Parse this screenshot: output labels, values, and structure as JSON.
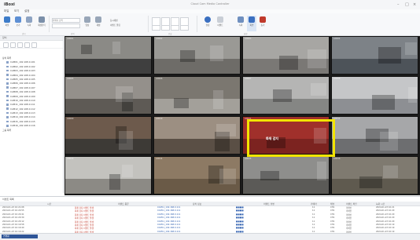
{
  "app": {
    "name": "iBoxi",
    "window_title": "Cloud Cam Media Controller"
  },
  "menubar": [
    "파일",
    "보기",
    "설정"
  ],
  "ribbon": {
    "buttons": [
      {
        "label": "파일",
        "icon": "home-icon"
      },
      {
        "label": "보기",
        "icon": "view-icon"
      },
      {
        "label": "녹화",
        "icon": "record-icon"
      },
      {
        "label": "재생관리",
        "icon": "playback-icon"
      },
      {
        "label": "영상",
        "icon": "camera-icon"
      },
      {
        "label": "재생",
        "icon": "play-icon"
      }
    ],
    "search_placeholder": "카메라 검색",
    "options": [
      "동시재생",
      "이벤트 알림"
    ],
    "group_labels": [
      "관리",
      "검색",
      "분할",
      "설정"
    ],
    "right_buttons": [
      {
        "label": "설정",
        "icon": "gear-icon"
      },
      {
        "label": "이벤트",
        "icon": "alert-icon"
      },
      {
        "label": "녹화",
        "icon": "record-icon"
      },
      {
        "label": "화면",
        "icon": "screen-icon"
      },
      {
        "label": "동기",
        "icon": "sync-icon"
      }
    ]
  },
  "sidebar": {
    "title": "장치",
    "tree": [
      "장치 목록",
      "CAM01_192.168.0.101",
      "CAM02_192.168.0.102",
      "CAM03_192.168.0.103",
      "CAM04_192.168.0.104",
      "CAM05_192.168.0.105",
      "CAM06_192.168.0.106",
      "CAM07_192.168.0.107",
      "CAM08_192.168.0.108",
      "CAM09_192.168.0.109",
      "CAM10_192.168.0.110",
      "CAM11_192.168.0.111",
      "CAM12_192.168.0.112",
      "CAM13_192.168.0.113",
      "CAM14_192.168.0.114",
      "CAM15_192.168.0.115",
      "CAM16_192.168.0.116",
      "그룹 목록"
    ],
    "tabs": [
      "장치",
      "그룹"
    ]
  },
  "video_grid": {
    "tiles": [
      {
        "stamp": "CAM01",
        "wall": "#8b8a86",
        "floor": "#3f3f3f"
      },
      {
        "stamp": "CAM02",
        "wall": "#9a9995",
        "floor": "#6e6c68"
      },
      {
        "stamp": "CAM03",
        "wall": "#a7a6a3",
        "floor": "#7a7875"
      },
      {
        "stamp": "CAM04",
        "wall": "#7d8287",
        "floor": "#4d5359"
      },
      {
        "stamp": "CAM05",
        "wall": "#94908b",
        "floor": "#5e5a55"
      },
      {
        "stamp": "CAM06",
        "wall": "#7b7770",
        "floor": "#a3a09a"
      },
      {
        "stamp": "CAM07",
        "wall": "#b5b5b4",
        "floor": "#858684"
      },
      {
        "stamp": "CAM08",
        "wall": "#c5c6c8",
        "floor": "#8d8f93"
      },
      {
        "stamp": "CAM09",
        "wall": "#6d5a4c",
        "floor": "#3d3a36"
      },
      {
        "stamp": "CAM10",
        "wall": "#9c8f82",
        "floor": "#5a4f45"
      },
      {
        "stamp": "CAM11",
        "wall": "#a0302b",
        "floor": "#7c2320"
      },
      {
        "stamp": "CAM12",
        "wall": "#a6a7a9",
        "floor": "#6d6e70"
      },
      {
        "stamp": "CAM13",
        "wall": "#c3c2be",
        "floor": "#8c8a85"
      },
      {
        "stamp": "CAM14",
        "wall": "#8d7a64",
        "floor": "#6a5a47"
      },
      {
        "stamp": "CAM15",
        "wall": "#8e8e8c",
        "floor": "#5b5a57"
      },
      {
        "stamp": "CAM16",
        "wall": "#7f7a70",
        "floor": "#5f5a4f"
      }
    ],
    "alert": {
      "label": "화재 감지",
      "border_color": "#f2e400"
    }
  },
  "events": {
    "title": "이벤트 목록",
    "columns": [
      "시간",
      "이벤트 종류",
      "장치 정보",
      "이벤트 설명",
      "카메라",
      "채널",
      "이벤트 확인",
      "녹화 시간"
    ],
    "rows": [
      {
        "time": "2024-01-23 10:21:08",
        "type": "화재 감지 이벤트 발생",
        "device": "CAM11_192.168.0.111",
        "desc": "■■■■",
        "cam": "11",
        "ch": "CH1",
        "ack": "미확인",
        "rec": "2024-01-23 10:21"
      },
      {
        "time": "2024-01-23 10:20:55",
        "type": "화재 감지 이벤트 발생",
        "device": "CAM11_192.168.0.111",
        "desc": "■■■■",
        "cam": "11",
        "ch": "CH1",
        "ack": "미확인",
        "rec": "2024-01-23 10:20"
      },
      {
        "time": "2024-01-23 10:20:41",
        "type": "화재 감지 이벤트 발생",
        "device": "CAM11_192.168.0.111",
        "desc": "■■■■",
        "cam": "11",
        "ch": "CH1",
        "ack": "미확인",
        "rec": "2024-01-23 10:20"
      },
      {
        "time": "2024-01-23 10:20:30",
        "type": "화재 감지 이벤트 발생",
        "device": "CAM11_192.168.0.111",
        "desc": "■■■■",
        "cam": "11",
        "ch": "CH1",
        "ack": "미확인",
        "rec": "2024-01-23 10:20"
      },
      {
        "time": "2024-01-23 10:20:12",
        "type": "화재 감지 이벤트 발생",
        "device": "CAM11_192.168.0.111",
        "desc": "■■■■",
        "cam": "11",
        "ch": "CH1",
        "ack": "미확인",
        "rec": "2024-01-23 10:20"
      },
      {
        "time": "2024-01-23 10:19:58",
        "type": "화재 감지 이벤트 발생",
        "device": "CAM11_192.168.0.111",
        "desc": "■■■■",
        "cam": "11",
        "ch": "CH1",
        "ack": "미확인",
        "rec": "2024-01-23 10:19"
      },
      {
        "time": "2024-01-23 10:19:40",
        "type": "화재 감지 이벤트 발생",
        "device": "CAM11_192.168.0.111",
        "desc": "■■■■",
        "cam": "11",
        "ch": "CH1",
        "ack": "미확인",
        "rec": "2024-01-23 10:19"
      },
      {
        "time": "2024-01-23 10:19:22",
        "type": "화재 감지 이벤트 발생",
        "device": "CAM11_192.168.0.111",
        "desc": "■■■■",
        "cam": "11",
        "ch": "CH1",
        "ack": "미확인",
        "rec": "2024-01-23 10:19"
      }
    ]
  },
  "status": {
    "label": "연결됨"
  }
}
